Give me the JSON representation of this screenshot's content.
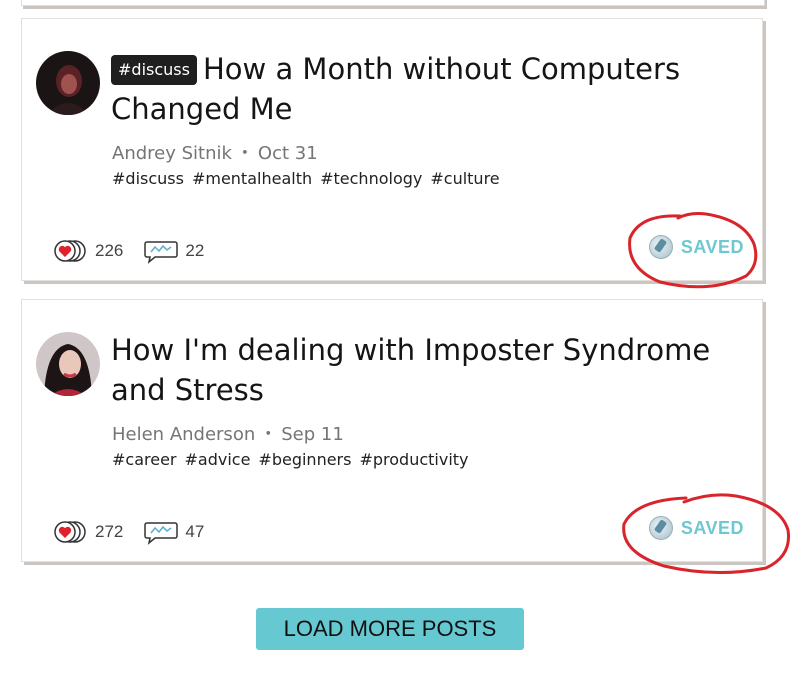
{
  "posts": [
    {
      "badge": "#discuss",
      "title": "How a Month without Computers Changed Me",
      "author": "Andrey Sitnik",
      "date": "Oct 31",
      "tags": [
        "#discuss",
        "#mentalhealth",
        "#technology",
        "#culture"
      ],
      "reactions": "226",
      "comments": "22",
      "saved_label": "SAVED"
    },
    {
      "badge": "",
      "title": "How I'm dealing with Imposter Syndrome and Stress",
      "author": "Helen Anderson",
      "date": "Sep 11",
      "tags": [
        "#career",
        "#advice",
        "#beginners",
        "#productivity"
      ],
      "reactions": "272",
      "comments": "47",
      "saved_label": "SAVED"
    }
  ],
  "load_more_label": "LOAD MORE POSTS",
  "separator": "・",
  "colors": {
    "accent": "#66c8d1",
    "saved_text": "#6fc8cf",
    "annotation": "#d8252b",
    "heart": "#e0202c"
  },
  "icons": {
    "reaction": "heart-icon",
    "comment": "comment-icon",
    "saved": "bookmark-icon"
  }
}
